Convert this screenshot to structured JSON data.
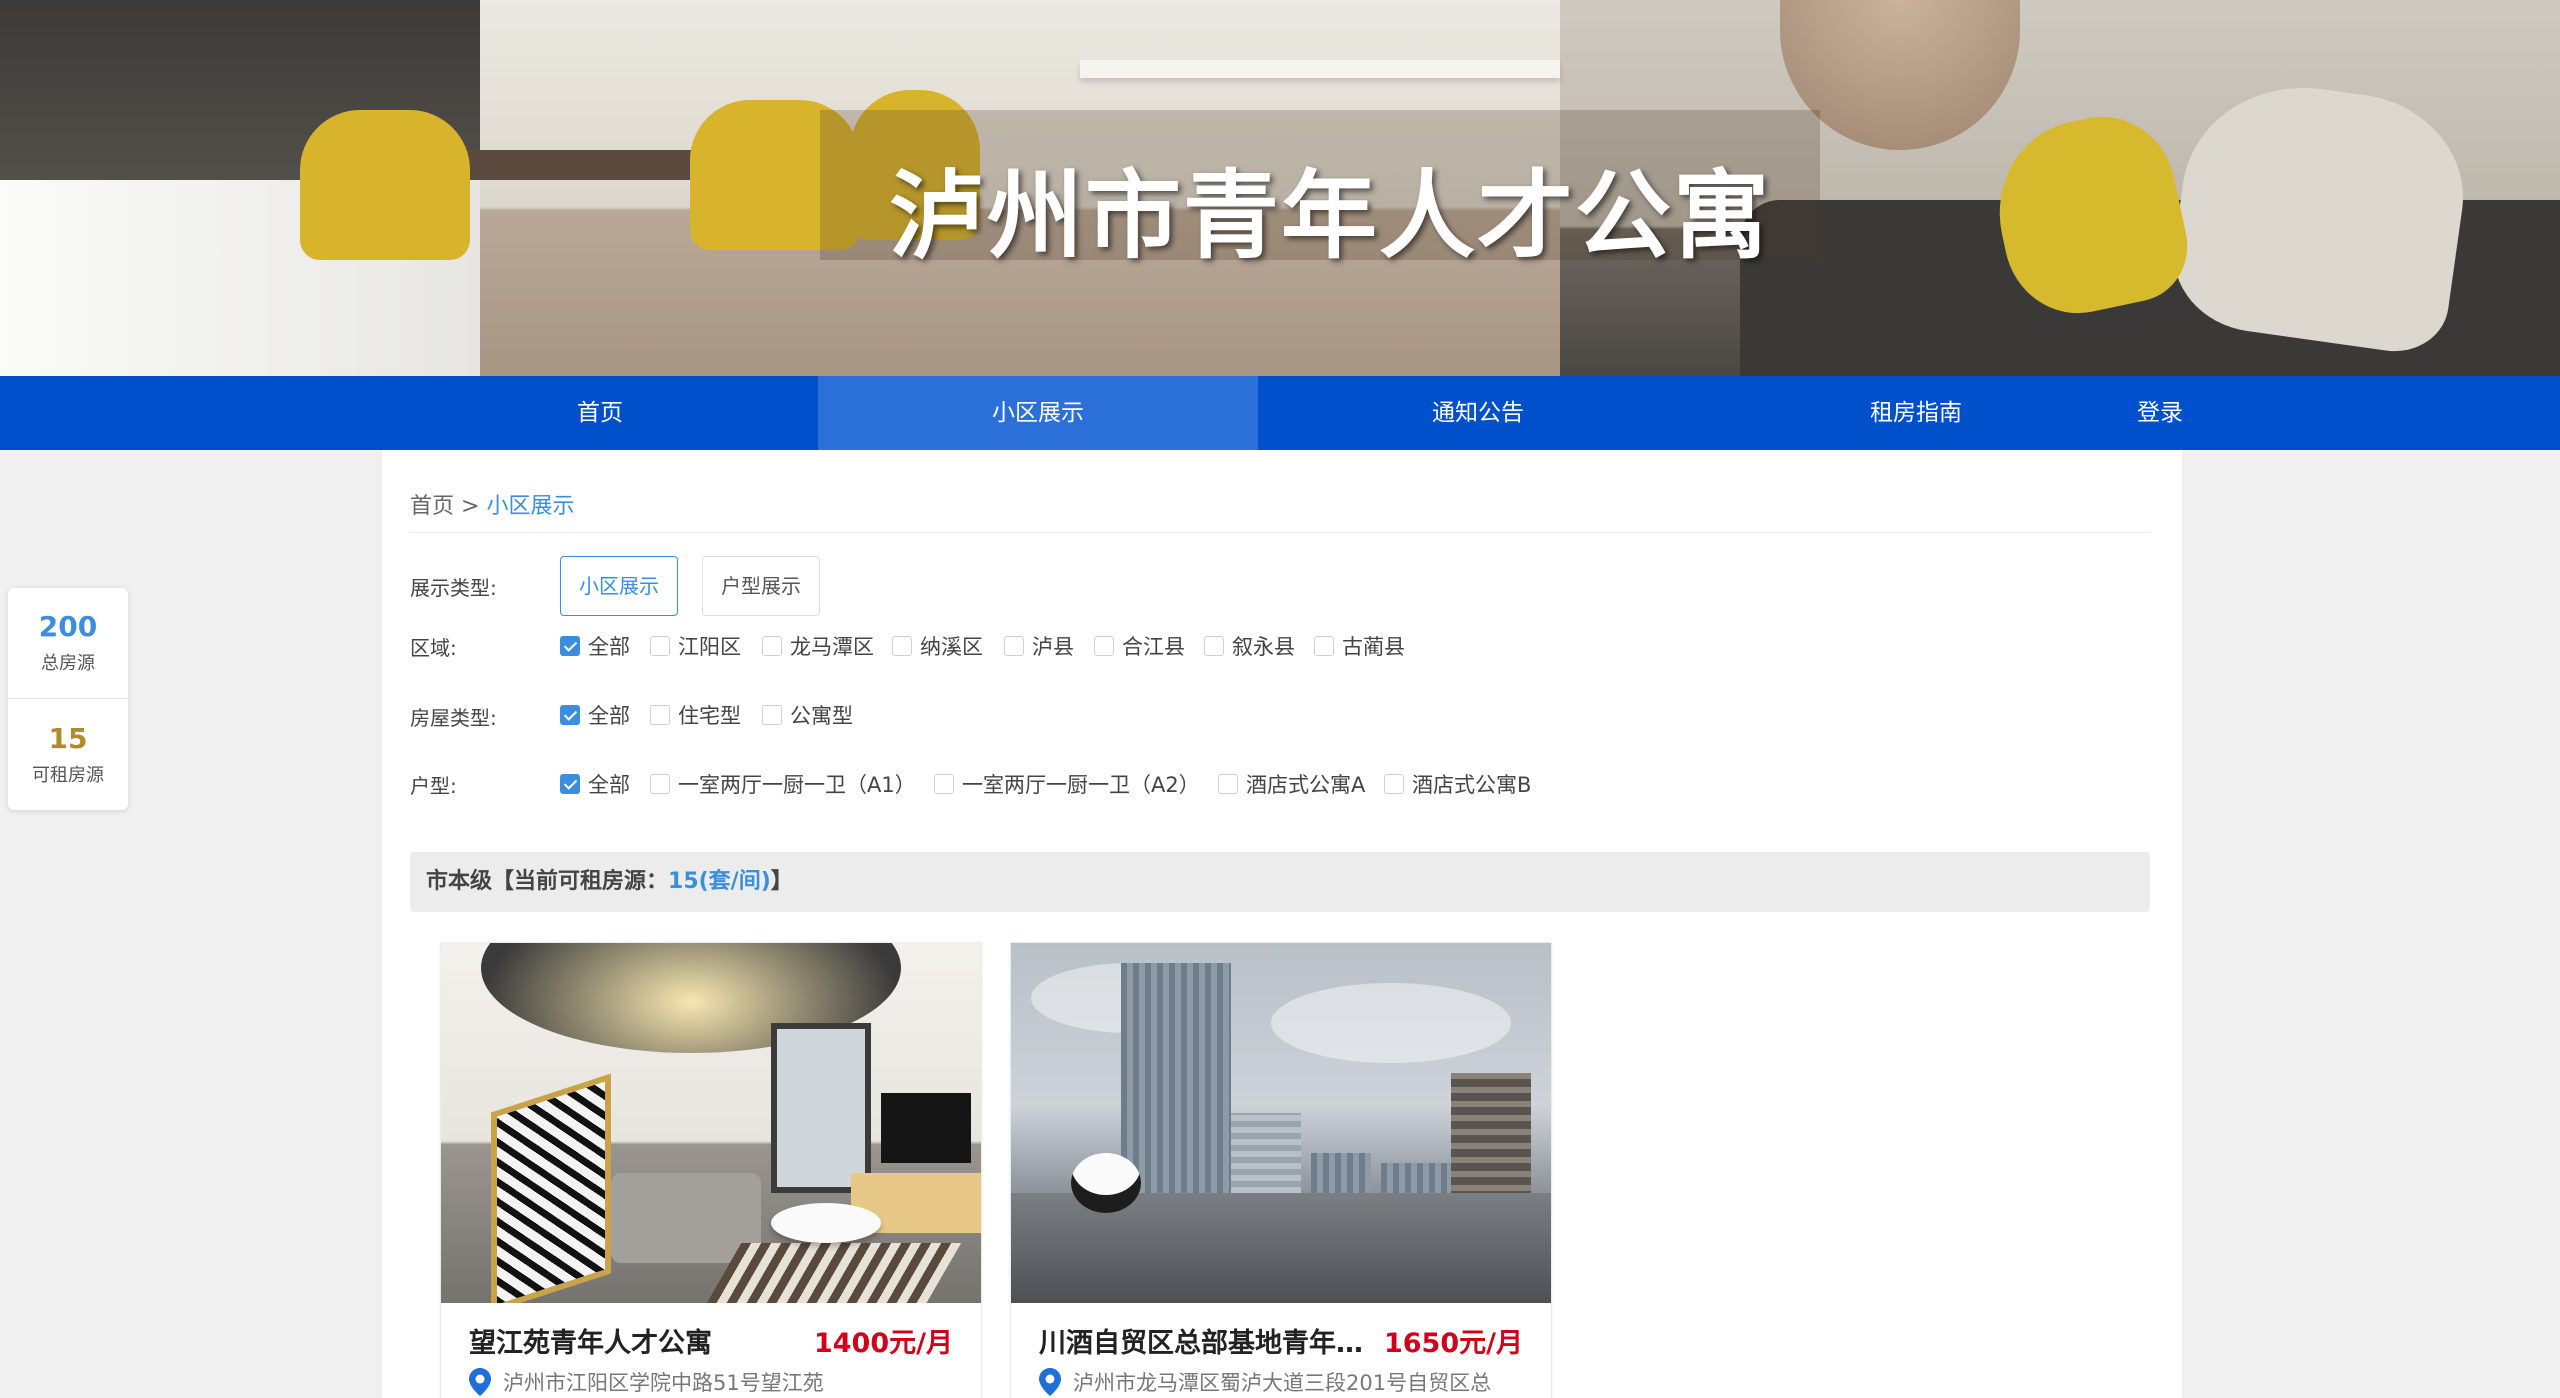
{
  "site": {
    "title": "泸州市青年人才公寓"
  },
  "nav": {
    "items": [
      {
        "label": "首页"
      },
      {
        "label": "小区展示"
      },
      {
        "label": "通知公告"
      },
      {
        "label": "租房指南"
      },
      {
        "label": "登录"
      }
    ],
    "active_index": 1
  },
  "stats": {
    "total": {
      "value": "200",
      "label": "总房源"
    },
    "available": {
      "value": "15",
      "label": "可租房源"
    }
  },
  "breadcrumb": {
    "home": "首页 >",
    "current": "小区展示"
  },
  "filters": {
    "display_type": {
      "label": "展示类型:",
      "options": [
        "小区展示",
        "户型展示"
      ],
      "selected": "小区展示"
    },
    "district": {
      "label": "区域:",
      "options": [
        "全部",
        "江阳区",
        "龙马潭区",
        "纳溪区",
        "泸县",
        "合江县",
        "叙永县",
        "古蔺县"
      ],
      "checked": [
        "全部"
      ]
    },
    "house_type": {
      "label": "房屋类型:",
      "options": [
        "全部",
        "住宅型",
        "公寓型"
      ],
      "checked": [
        "全部"
      ]
    },
    "layout": {
      "label": "户型:",
      "options": [
        "全部",
        "一室两厅一厨一卫（A1）",
        "一室两厅一厨一卫（A2）",
        "酒店式公寓A",
        "酒店式公寓B"
      ],
      "checked": [
        "全部"
      ]
    }
  },
  "section": {
    "prefix": "市本级【当前可租房源：",
    "count": "15(套/间)",
    "suffix": "】"
  },
  "listings": [
    {
      "name": "望江苑青年人才公寓",
      "price": "1400元/月",
      "address": "泸州市江阳区学院中路51号望江苑"
    },
    {
      "name": "川酒自贸区总部基地青年…",
      "price": "1650元/月",
      "address": "泸州市龙马潭区蜀泸大道三段201号自贸区总"
    }
  ],
  "colors": {
    "nav": "#0050cc",
    "nav_active": "#2b70d8",
    "accent": "#3b8ede",
    "price": "#d0021b",
    "available": "#b28a2e"
  }
}
